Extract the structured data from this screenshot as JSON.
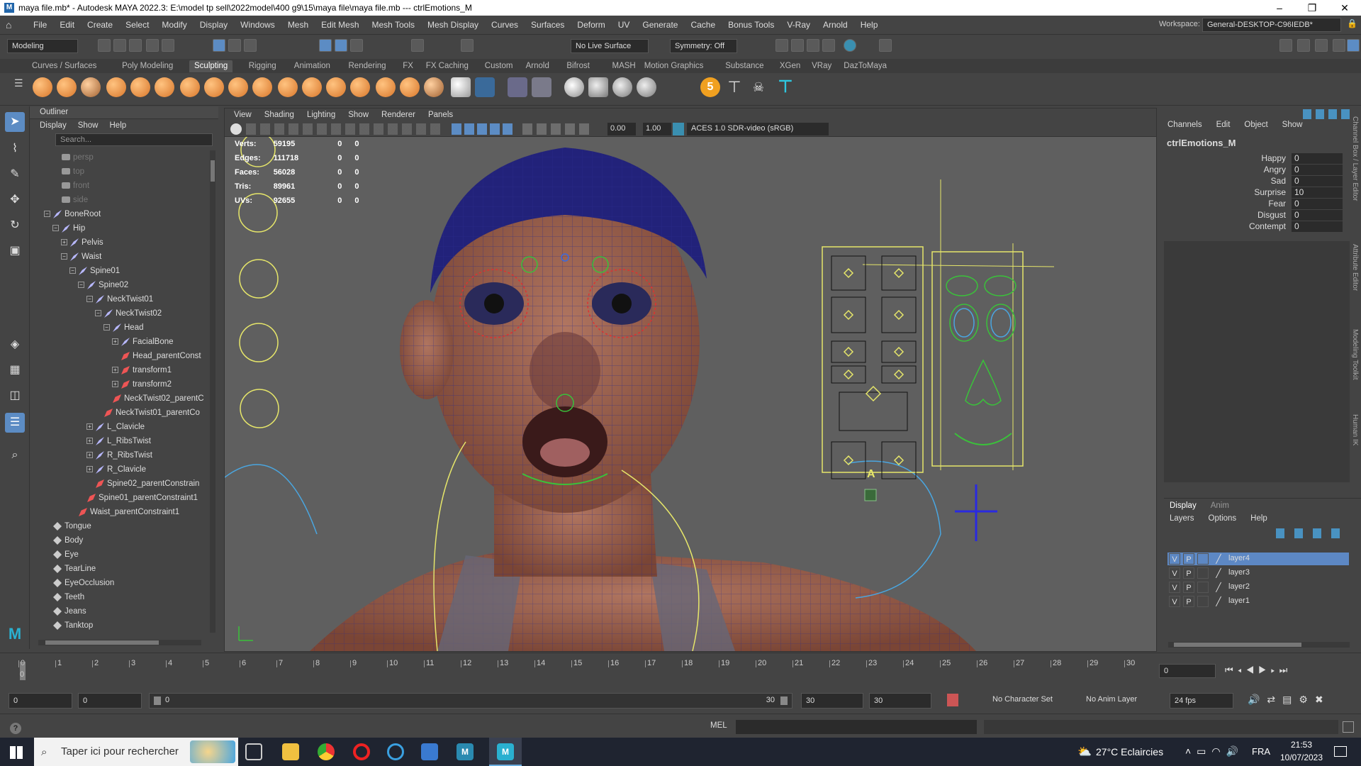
{
  "titlebar": {
    "title": "maya file.mb* - Autodesk MAYA 2022.3: E:\\model tp sell\\2022model\\400 g9\\15\\maya file\\maya file.mb  ---  ctrlEmotions_M",
    "min": "–",
    "max": "❐",
    "close": "✕"
  },
  "menubar": [
    "File",
    "Edit",
    "Create",
    "Select",
    "Modify",
    "Display",
    "Windows",
    "Mesh",
    "Edit Mesh",
    "Mesh Tools",
    "Mesh Display",
    "Curves",
    "Surfaces",
    "Deform",
    "UV",
    "Generate",
    "Cache",
    "Bonus Tools",
    "V-Ray",
    "Arnold",
    "Help"
  ],
  "workspace": {
    "label": "Workspace:",
    "value": "General-DESKTOP-C96IEDB*"
  },
  "statusline": {
    "mode": "Modeling",
    "live_surface": "No Live Surface",
    "symmetry": "Symmetry: Off"
  },
  "shelf_tabs": [
    "Curves / Surfaces",
    "Poly Modeling",
    "Sculpting",
    "Rigging",
    "Animation",
    "Rendering",
    "FX",
    "FX Caching",
    "Custom",
    "Arnold",
    "Bifrost",
    "MASH",
    "Motion Graphics",
    "Substance",
    "XGen",
    "VRay",
    "DazToMaya"
  ],
  "shelf_active": "Sculpting",
  "outliner": {
    "title": "Outliner",
    "menu": [
      "Display",
      "Show",
      "Help"
    ],
    "search_placeholder": "Search...",
    "items": [
      {
        "label": "persp",
        "indent": 2,
        "icon": "cam",
        "dim": true,
        "expand": ""
      },
      {
        "label": "top",
        "indent": 2,
        "icon": "cam",
        "dim": true,
        "expand": ""
      },
      {
        "label": "front",
        "indent": 2,
        "icon": "cam",
        "dim": true,
        "expand": ""
      },
      {
        "label": "side",
        "indent": 2,
        "icon": "cam",
        "dim": true,
        "expand": ""
      },
      {
        "label": "BoneRoot",
        "indent": 1,
        "icon": "joint",
        "expand": "−"
      },
      {
        "label": "Hip",
        "indent": 2,
        "icon": "joint",
        "expand": "−"
      },
      {
        "label": "Pelvis",
        "indent": 3,
        "icon": "joint",
        "expand": "+"
      },
      {
        "label": "Waist",
        "indent": 3,
        "icon": "joint",
        "expand": "−"
      },
      {
        "label": "Spine01",
        "indent": 4,
        "icon": "joint",
        "expand": "−"
      },
      {
        "label": "Spine02",
        "indent": 5,
        "icon": "joint",
        "expand": "−"
      },
      {
        "label": "NeckTwist01",
        "indent": 6,
        "icon": "joint",
        "expand": "−"
      },
      {
        "label": "NeckTwist02",
        "indent": 7,
        "icon": "joint",
        "expand": "−"
      },
      {
        "label": "Head",
        "indent": 8,
        "icon": "joint",
        "expand": "−"
      },
      {
        "label": "FacialBone",
        "indent": 9,
        "icon": "joint",
        "expand": "+"
      },
      {
        "label": "Head_parentConst",
        "indent": 9,
        "icon": "cons",
        "expand": ""
      },
      {
        "label": "transform1",
        "indent": 9,
        "icon": "cons",
        "expand": "+"
      },
      {
        "label": "transform2",
        "indent": 9,
        "icon": "cons",
        "expand": "+"
      },
      {
        "label": "NeckTwist02_parentC",
        "indent": 8,
        "icon": "cons",
        "expand": ""
      },
      {
        "label": "NeckTwist01_parentCo",
        "indent": 7,
        "icon": "cons",
        "expand": ""
      },
      {
        "label": "L_Clavicle",
        "indent": 6,
        "icon": "joint",
        "expand": "+"
      },
      {
        "label": "L_RibsTwist",
        "indent": 6,
        "icon": "joint",
        "expand": "+"
      },
      {
        "label": "R_RibsTwist",
        "indent": 6,
        "icon": "joint",
        "expand": "+"
      },
      {
        "label": "R_Clavicle",
        "indent": 6,
        "icon": "joint",
        "expand": "+"
      },
      {
        "label": "Spine02_parentConstrain",
        "indent": 6,
        "icon": "cons",
        "expand": ""
      },
      {
        "label": "Spine01_parentConstraint1",
        "indent": 5,
        "icon": "cons",
        "expand": ""
      },
      {
        "label": "Waist_parentConstraint1",
        "indent": 4,
        "icon": "cons",
        "expand": ""
      },
      {
        "label": "Tongue",
        "indent": 1,
        "icon": "mesh",
        "expand": ""
      },
      {
        "label": "Body",
        "indent": 1,
        "icon": "mesh",
        "expand": ""
      },
      {
        "label": "Eye",
        "indent": 1,
        "icon": "mesh",
        "expand": ""
      },
      {
        "label": "TearLine",
        "indent": 1,
        "icon": "mesh",
        "expand": ""
      },
      {
        "label": "EyeOcclusion",
        "indent": 1,
        "icon": "mesh",
        "expand": ""
      },
      {
        "label": "Teeth",
        "indent": 1,
        "icon": "mesh",
        "expand": ""
      },
      {
        "label": "Jeans",
        "indent": 1,
        "icon": "mesh",
        "expand": ""
      },
      {
        "label": "Tanktop",
        "indent": 1,
        "icon": "mesh",
        "expand": ""
      }
    ]
  },
  "viewport": {
    "menu": [
      "View",
      "Shading",
      "Lighting",
      "Show",
      "Renderer",
      "Panels"
    ],
    "exposure": "0.00",
    "gamma": "1.00",
    "colorspace": "ACES 1.0 SDR-video (sRGB)",
    "hud": [
      [
        "Verts:",
        "59195",
        "0",
        "0"
      ],
      [
        "Edges:",
        "111718",
        "0",
        "0"
      ],
      [
        "Faces:",
        "56028",
        "0",
        "0"
      ],
      [
        "Tris:",
        "89961",
        "0",
        "0"
      ],
      [
        "UVs:",
        "92655",
        "0",
        "0"
      ]
    ],
    "panel_letter": "A"
  },
  "channel_box": {
    "tabs": [
      "Channels",
      "Edit",
      "Object",
      "Show"
    ],
    "node": "ctrlEmotions_M",
    "attributes": [
      {
        "name": "Happy",
        "value": "0"
      },
      {
        "name": "Angry",
        "value": "0"
      },
      {
        "name": "Sad",
        "value": "0"
      },
      {
        "name": "Surprise",
        "value": "10"
      },
      {
        "name": "Fear",
        "value": "0"
      },
      {
        "name": "Disgust",
        "value": "0"
      },
      {
        "name": "Contempt",
        "value": "0"
      }
    ],
    "side_tabs": [
      "Channel Box / Layer Editor",
      "Attribute Editor",
      "Modeling Toolkit",
      "Human IK"
    ]
  },
  "layer_editor": {
    "tabs": [
      "Display",
      "Anim"
    ],
    "menu": [
      "Layers",
      "Options",
      "Help"
    ],
    "layers": [
      {
        "v": "V",
        "p": "P",
        "name": "layer4",
        "selected": true
      },
      {
        "v": "V",
        "p": "P",
        "name": "layer3"
      },
      {
        "v": "V",
        "p": "P",
        "name": "layer2"
      },
      {
        "v": "V",
        "p": "P",
        "name": "layer1"
      }
    ]
  },
  "timeline": {
    "start": 0,
    "end": 30,
    "current_frame": "0",
    "current_field": "0"
  },
  "range": {
    "start": "0",
    "inner_start": "0",
    "slider_start": "0",
    "slider_end": "30",
    "inner_end": "30",
    "end": "30",
    "character_set": "No Character Set",
    "anim_layer": "No Anim Layer",
    "fps": "24 fps"
  },
  "cmdline": {
    "label": "MEL"
  },
  "taskbar": {
    "search": "Taper ici pour rechercher",
    "weather": "27°C Eclaircies",
    "lang": "FRA",
    "time": "21:53",
    "date": "10/07/2023"
  }
}
